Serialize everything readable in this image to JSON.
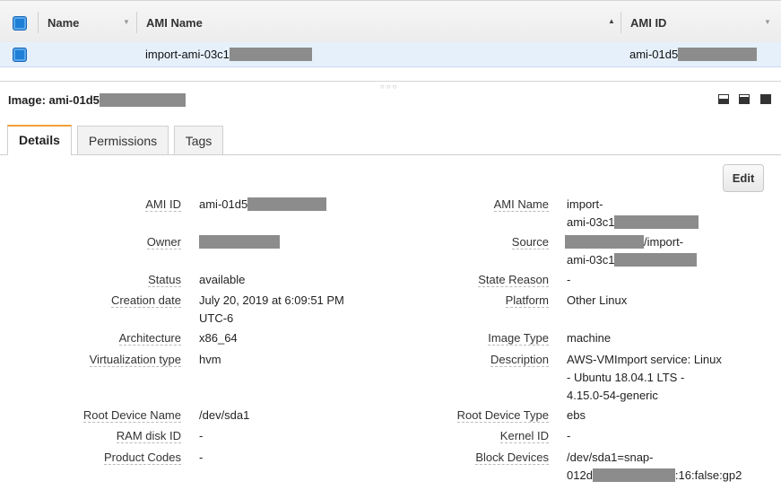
{
  "table": {
    "columns": [
      {
        "label": "Name"
      },
      {
        "label": "AMI Name"
      },
      {
        "label": "AMI ID"
      }
    ],
    "row": {
      "ami_name": "import-ami-03c1",
      "ami_id": "ami-01d5"
    }
  },
  "detail": {
    "title": "Image: ami-01d5",
    "tabs": [
      {
        "label": "Details"
      },
      {
        "label": "Permissions"
      },
      {
        "label": "Tags"
      }
    ],
    "edit_label": "Edit",
    "left_fields": [
      {
        "label": "AMI ID",
        "value": "ami-01d5"
      },
      {
        "label": "Owner",
        "value": ""
      },
      {
        "label": "Status",
        "value": "available"
      },
      {
        "label": "Creation date",
        "value": "July 20, 2019 at 6:09:51 PM",
        "value2": "UTC-6"
      },
      {
        "label": "Architecture",
        "value": "x86_64"
      },
      {
        "label": "Virtualization type",
        "value": "hvm"
      },
      {
        "label": "Root Device Name",
        "value": "/dev/sda1"
      },
      {
        "label": "RAM disk ID",
        "value": "-"
      },
      {
        "label": "Product Codes",
        "value": "-"
      }
    ],
    "right_fields": [
      {
        "label": "AMI Name",
        "value": "import-",
        "value2": "ami-03c1"
      },
      {
        "label": "Source",
        "value": "/import-",
        "value2": "ami-03c1"
      },
      {
        "label": "State Reason",
        "value": "-"
      },
      {
        "label": "Platform",
        "value": "Other Linux"
      },
      {
        "label": "Image Type",
        "value": "machine"
      },
      {
        "label": "Description",
        "value": "AWS-VMImport service: Linux",
        "value2": "- Ubuntu 18.04.1 LTS -",
        "value3": "4.15.0-54-generic"
      },
      {
        "label": "Root Device Type",
        "value": "ebs"
      },
      {
        "label": "Kernel ID",
        "value": "-"
      },
      {
        "label": "Block Devices",
        "value": "/dev/sda1=snap-",
        "value2": "012d",
        "value2b": ":16:false:gp2"
      }
    ]
  },
  "colors": {
    "accent_tab": "#f1a034",
    "checkbox": "#1f7fd6",
    "selected_row": "#e6f0fb"
  }
}
